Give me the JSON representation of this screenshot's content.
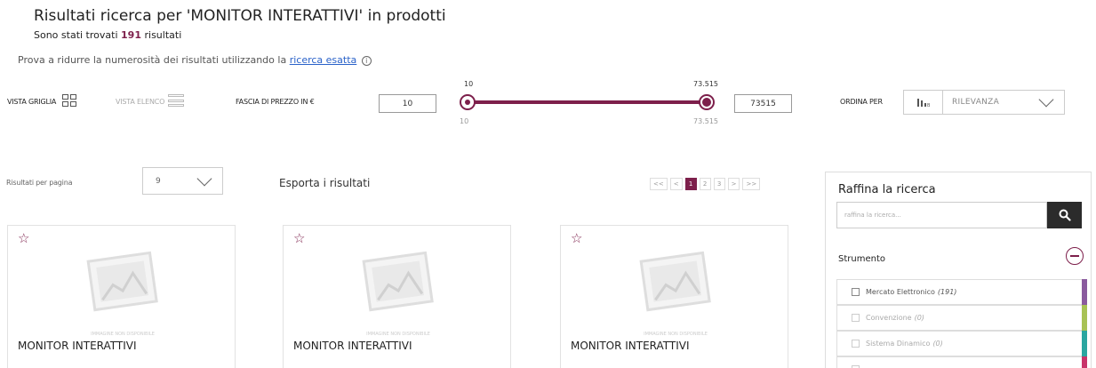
{
  "header": {
    "title": "Risultati ricerca per 'MONITOR INTERATTIVI' in prodotti",
    "subtitle_prefix": "Sono stati trovati",
    "result_count": "191",
    "subtitle_suffix": "risultati",
    "hint_text": "Prova a ridurre la numerosità dei risultati utilizzando la",
    "hint_link": "ricerca esatta"
  },
  "toolbar": {
    "grid_view_label": "VISTA GRIGLIA",
    "list_view_label": "VISTA ELENCO",
    "price_range_label": "FASCIA DI PREZZO IN €",
    "price_min": "10",
    "price_max": "73515",
    "slider_min_top": "10",
    "slider_max_top": "73.515",
    "slider_min_bottom": "10",
    "slider_max_bottom": "73.515",
    "sort_label": "ORDINA PER",
    "sort_value": "RILEVANZA",
    "sort_icon": "sort-bars-icon"
  },
  "results_bar": {
    "per_page_label": "Risultati per pagina",
    "per_page_value": "9",
    "export_label": "Esporta i risultati",
    "pagination": [
      "<<",
      "<",
      "1",
      "2",
      "3",
      ">",
      ">>"
    ],
    "current_page": "1"
  },
  "products": [
    {
      "title": "MONITOR INTERATTIVI",
      "image_caption": "IMMAGINE NON DISPONIBILE"
    },
    {
      "title": "MONITOR INTERATTIVI",
      "image_caption": "IMMAGINE NON DISPONIBILE"
    },
    {
      "title": "MONITOR INTERATTIVI",
      "image_caption": "IMMAGINE NON DISPONIBILE"
    }
  ],
  "sidebar": {
    "title": "Raffina la ricerca",
    "search_placeholder": "raffina la ricerca...",
    "section_title": "Strumento",
    "filters": [
      {
        "label": "Mercato Elettronico",
        "count": "(191)",
        "color": "#8a5a9e"
      },
      {
        "label": "Convenzione",
        "count": "(0)",
        "color": "#a8c255"
      },
      {
        "label": "Sistema Dinamico",
        "count": "(0)",
        "color": "#2aa6a0"
      }
    ]
  },
  "colors": {
    "accent": "#7d1f4b",
    "link": "#2a62c9"
  }
}
